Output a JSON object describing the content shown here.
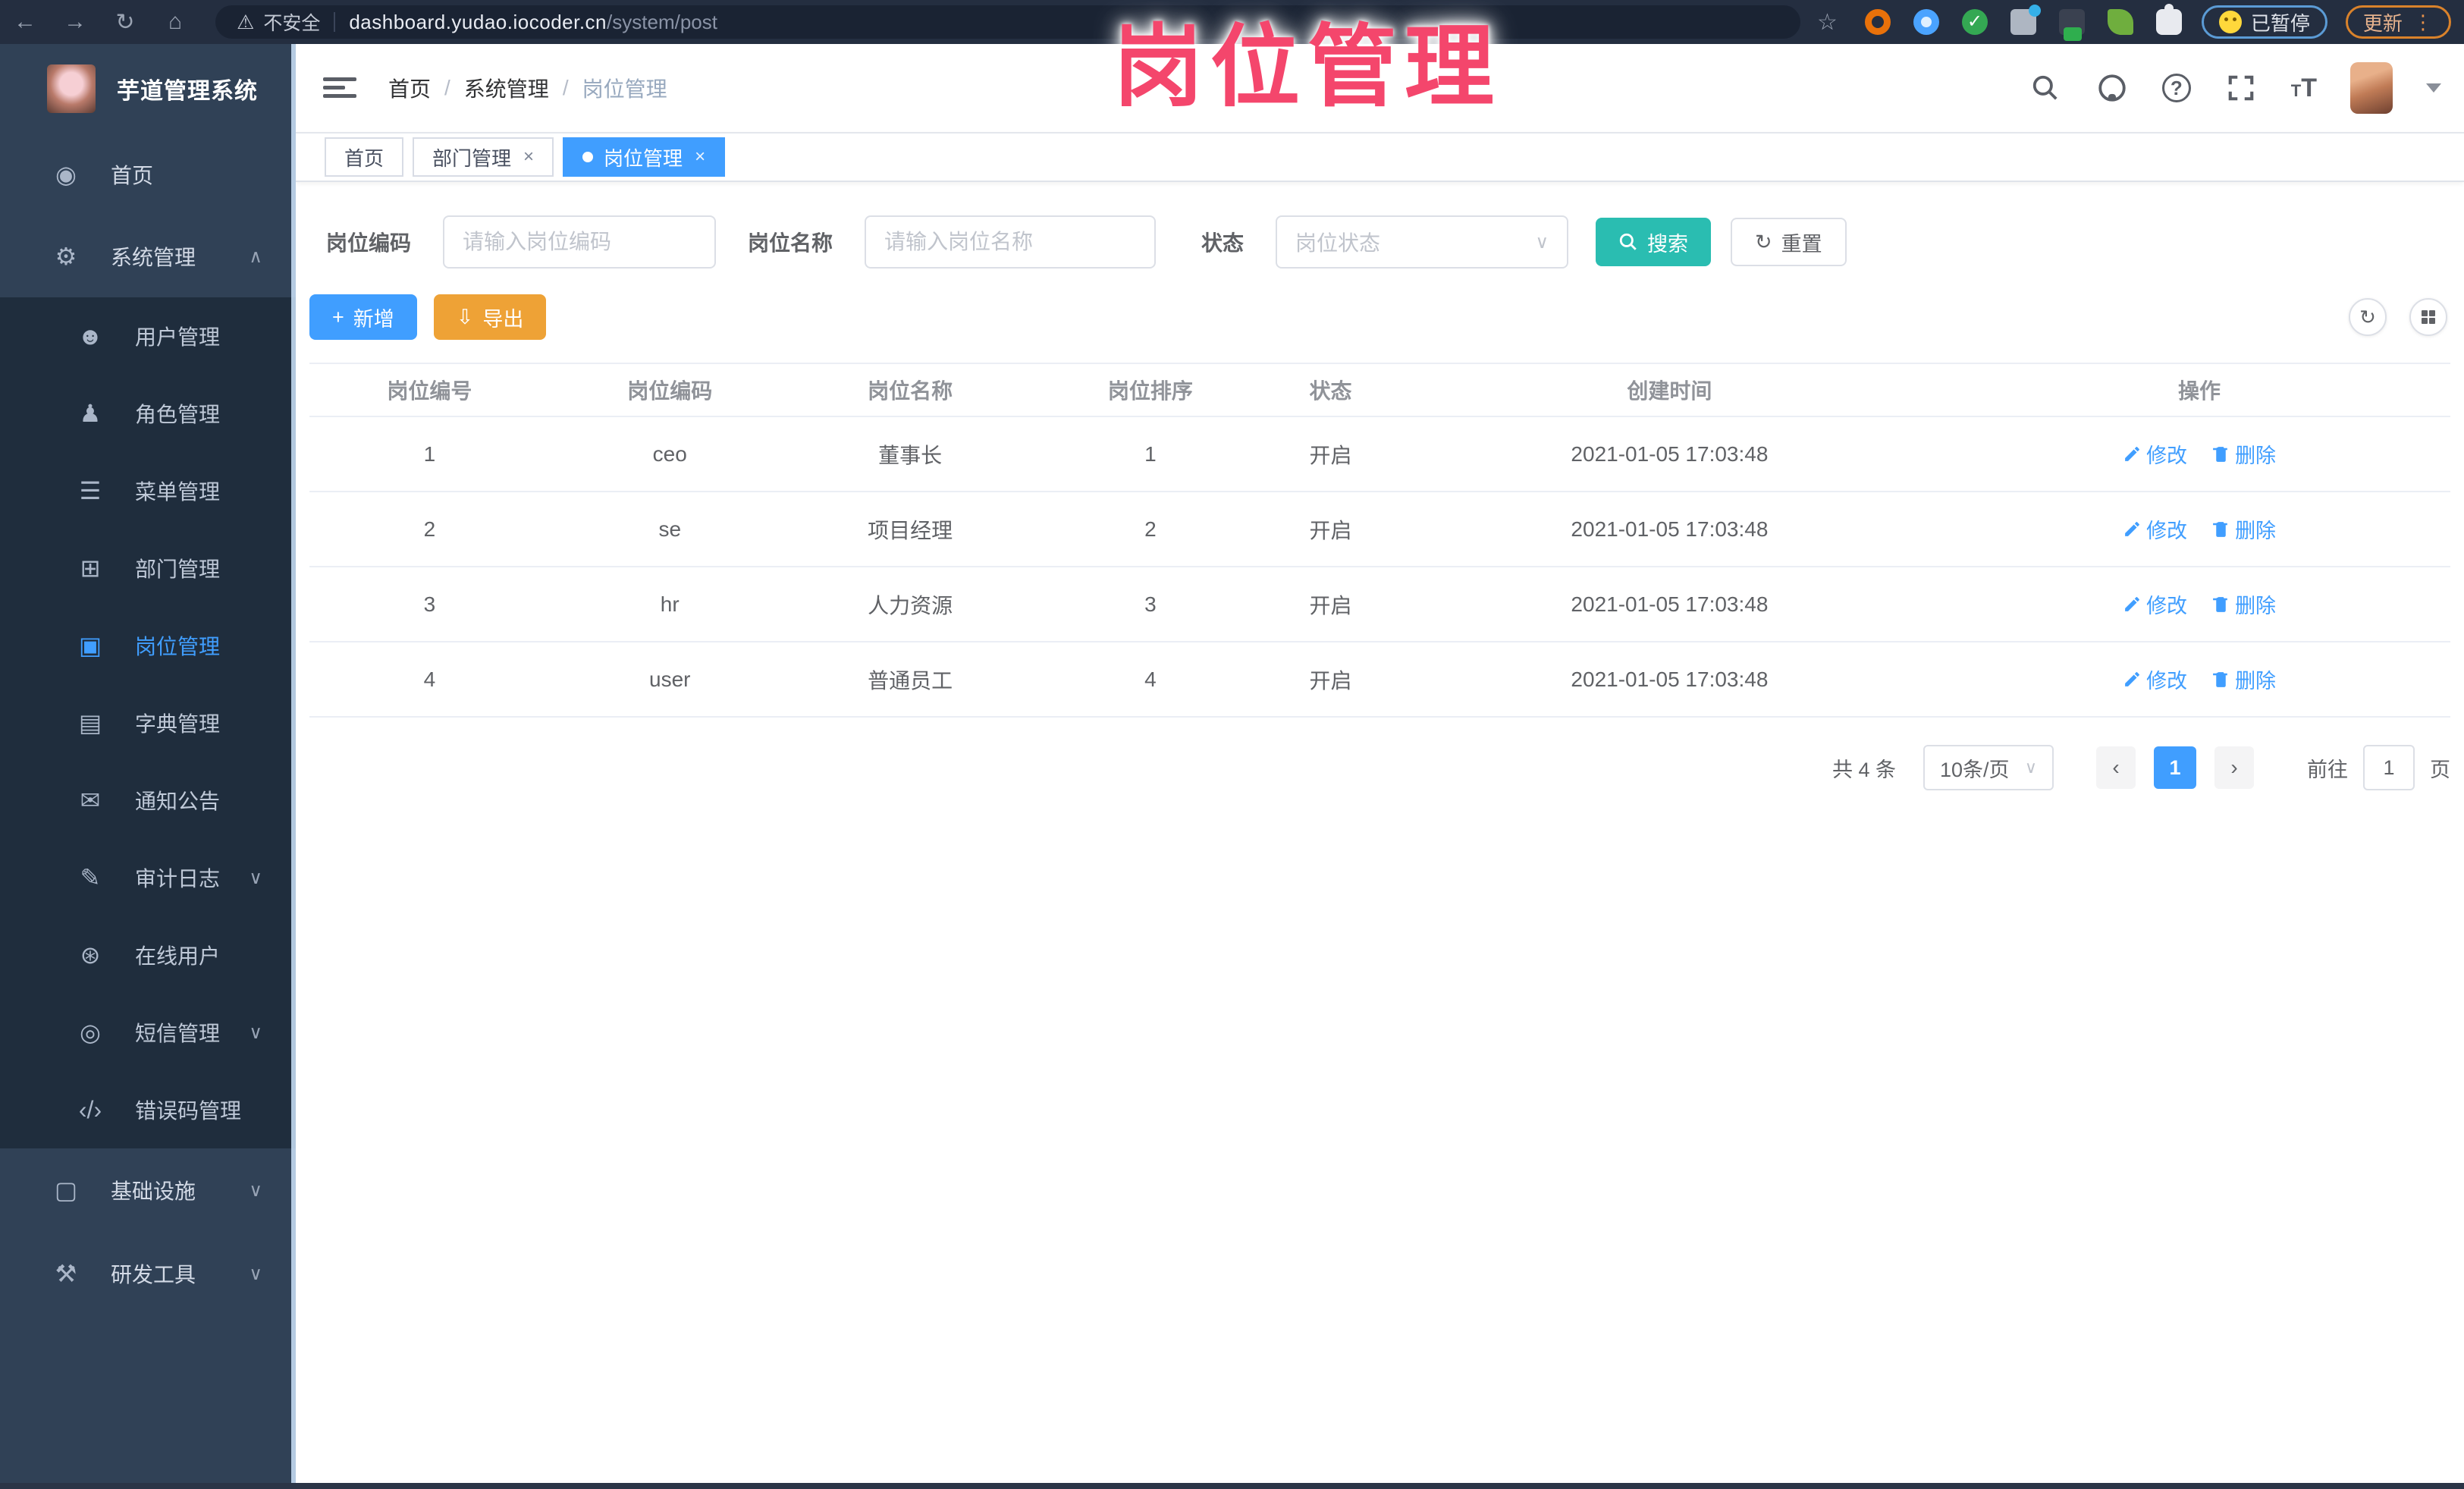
{
  "annotation": {
    "title": "岗位管理"
  },
  "browser": {
    "security_label": "不安全",
    "url_host": "dashboard.yudao.iocoder.cn",
    "url_path": "/system/post",
    "paused_badge": "已暂停",
    "update_badge": "更新"
  },
  "sidebar": {
    "app_title": "芋道管理系统",
    "items": [
      {
        "label": "首页",
        "icon": "dashboard-icon",
        "level": "root"
      },
      {
        "label": "系统管理",
        "icon": "gear-icon",
        "level": "root",
        "chevron": "up"
      },
      {
        "label": "用户管理",
        "icon": "user-icon",
        "level": "sub"
      },
      {
        "label": "角色管理",
        "icon": "role-icon",
        "level": "sub"
      },
      {
        "label": "菜单管理",
        "icon": "menu-list-icon",
        "level": "sub"
      },
      {
        "label": "部门管理",
        "icon": "org-tree-icon",
        "level": "sub"
      },
      {
        "label": "岗位管理",
        "icon": "post-icon",
        "level": "sub",
        "active": true
      },
      {
        "label": "字典管理",
        "icon": "dictionary-icon",
        "level": "sub"
      },
      {
        "label": "通知公告",
        "icon": "announcement-icon",
        "level": "sub"
      },
      {
        "label": "审计日志",
        "icon": "audit-log-icon",
        "level": "sub",
        "chevron": "down"
      },
      {
        "label": "在线用户",
        "icon": "online-user-icon",
        "level": "sub"
      },
      {
        "label": "短信管理",
        "icon": "sms-icon",
        "level": "sub",
        "chevron": "down"
      },
      {
        "label": "错误码管理",
        "icon": "error-code-icon",
        "level": "sub"
      },
      {
        "label": "基础设施",
        "icon": "infrastructure-icon",
        "level": "root-b",
        "chevron": "down"
      },
      {
        "label": "研发工具",
        "icon": "dev-tools-icon",
        "level": "root-b",
        "chevron": "down"
      }
    ]
  },
  "header": {
    "breadcrumb": [
      "首页",
      "系统管理",
      "岗位管理"
    ]
  },
  "tabs": [
    {
      "label": "首页",
      "closable": false,
      "active": false
    },
    {
      "label": "部门管理",
      "closable": true,
      "active": false
    },
    {
      "label": "岗位管理",
      "closable": true,
      "active": true
    }
  ],
  "filters": {
    "code_label": "岗位编码",
    "code_placeholder": "请输入岗位编码",
    "name_label": "岗位名称",
    "name_placeholder": "请输入岗位名称",
    "status_label": "状态",
    "status_placeholder": "岗位状态",
    "search_label": "搜索",
    "reset_label": "重置"
  },
  "toolbar": {
    "add_label": "新增",
    "export_label": "导出"
  },
  "table": {
    "columns": [
      "岗位编号",
      "岗位编码",
      "岗位名称",
      "岗位排序",
      "状态",
      "创建时间",
      "操作"
    ],
    "rows": [
      {
        "id": "1",
        "code": "ceo",
        "name": "董事长",
        "sort": "1",
        "status": "开启",
        "created": "2021-01-05 17:03:48"
      },
      {
        "id": "2",
        "code": "se",
        "name": "项目经理",
        "sort": "2",
        "status": "开启",
        "created": "2021-01-05 17:03:48"
      },
      {
        "id": "3",
        "code": "hr",
        "name": "人力资源",
        "sort": "3",
        "status": "开启",
        "created": "2021-01-05 17:03:48"
      },
      {
        "id": "4",
        "code": "user",
        "name": "普通员工",
        "sort": "4",
        "status": "开启",
        "created": "2021-01-05 17:03:48"
      }
    ],
    "edit_label": "修改",
    "delete_label": "删除"
  },
  "pagination": {
    "total": "共 4 条",
    "page_size": "10条/页",
    "page": "1",
    "goto_label": "前往",
    "goto_value": "1",
    "unit_label": "页"
  },
  "colors": {
    "primary": "#409eff",
    "warning": "#eea236",
    "search_teal": "#2abdb1",
    "annotation_pink": "#f4466c",
    "sidebar_bg": "#304156",
    "submenu_bg": "#1f2d3d"
  }
}
